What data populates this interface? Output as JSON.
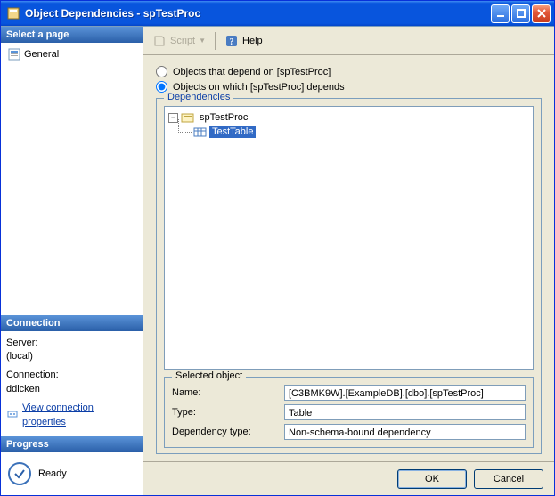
{
  "window": {
    "title": "Object Dependencies - spTestProc"
  },
  "left": {
    "select_page": "Select a page",
    "general": "General",
    "connection_header": "Connection",
    "server_label": "Server:",
    "server_value": "(local)",
    "connection_label": "Connection:",
    "connection_value": "ddicken",
    "view_conn_props": "View connection properties",
    "progress_header": "Progress",
    "progress_status": "Ready"
  },
  "toolbar": {
    "script": "Script",
    "help": "Help"
  },
  "radios": {
    "depend_on": "Objects that depend on [spTestProc]",
    "depends": "Objects on which [spTestProc] depends"
  },
  "tree": {
    "legend": "Dependencies",
    "root": "spTestProc",
    "child": "TestTable"
  },
  "selected": {
    "legend": "Selected object",
    "name_label": "Name:",
    "name_value": "[C3BMK9W].[ExampleDB].[dbo].[spTestProc]",
    "type_label": "Type:",
    "type_value": "Table",
    "deptype_label": "Dependency type:",
    "deptype_value": "Non-schema-bound dependency"
  },
  "footer": {
    "ok": "OK",
    "cancel": "Cancel"
  }
}
